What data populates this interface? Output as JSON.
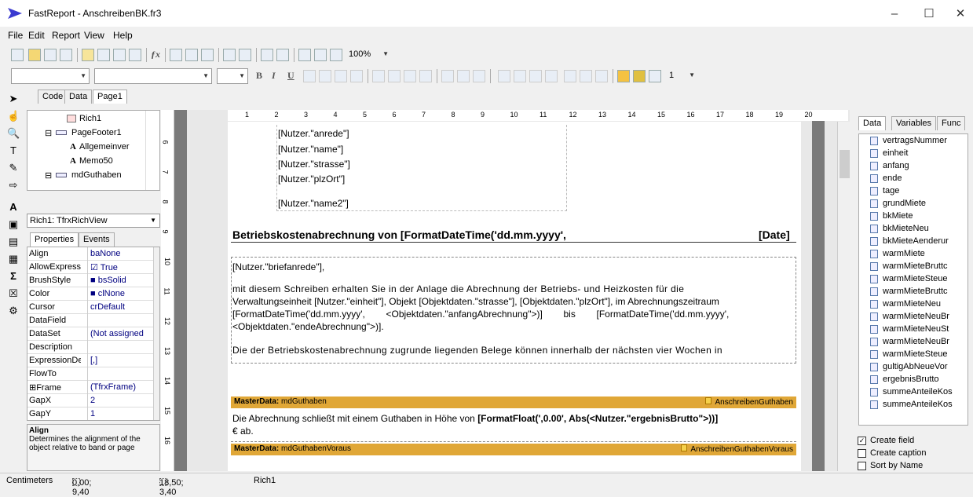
{
  "window": {
    "title": "FastReport - AnschreibenBK.fr3",
    "minimize": "–",
    "maximize": "☐",
    "close": "✕"
  },
  "menu": [
    "File",
    "Edit",
    "Report",
    "View",
    "Help"
  ],
  "toolbar": {
    "zoom": "100%",
    "linewidth": "1",
    "bold": "B",
    "italic": "I",
    "underline": "U"
  },
  "editor_tabs": [
    "Code",
    "Data",
    "Page1"
  ],
  "tree": [
    {
      "label": "Rich1",
      "indent": 60
    },
    {
      "label": "PageFooter1",
      "indent": 38
    },
    {
      "label": "Allgemeinver",
      "indent": 60
    },
    {
      "label": "Memo50",
      "indent": 60
    },
    {
      "label": "mdGuthaben",
      "indent": 38
    }
  ],
  "object_selector": "Rich1: TfrxRichView",
  "prop_tabs": [
    "Properties",
    "Events"
  ],
  "properties": [
    {
      "name": "Align",
      "value": "baNone"
    },
    {
      "name": "AllowExpress",
      "value": "☑ True"
    },
    {
      "name": "BrushStyle",
      "value": "■ bsSolid"
    },
    {
      "name": "Color",
      "value": "■ clNone"
    },
    {
      "name": "Cursor",
      "value": "crDefault"
    },
    {
      "name": "DataField",
      "value": ""
    },
    {
      "name": "DataSet",
      "value": "(Not assigned"
    },
    {
      "name": "Description",
      "value": ""
    },
    {
      "name": "ExpressionDe",
      "value": "[,]"
    },
    {
      "name": "FlowTo",
      "value": ""
    },
    {
      "name": "⊞Frame",
      "value": "(TfrxFrame)"
    },
    {
      "name": "GapX",
      "value": "2"
    },
    {
      "name": "GapY",
      "value": "1"
    }
  ],
  "prop_desc": {
    "title": "Align",
    "text": "Determines the alignment of the object relative to band or page"
  },
  "hruler": [
    "1",
    "2",
    "3",
    "4",
    "5",
    "6",
    "7",
    "8",
    "9",
    "10",
    "11",
    "12",
    "13",
    "14",
    "15",
    "16",
    "17",
    "18",
    "19",
    "20"
  ],
  "vruler": [
    "6",
    "7",
    "8",
    "9",
    "10",
    "11",
    "12",
    "13",
    "14",
    "15",
    "16"
  ],
  "page": {
    "address": [
      "[Nutzer.\"anrede\"]",
      "[Nutzer.\"name\"]",
      "[Nutzer.\"strasse\"]",
      "[Nutzer.\"plzOrt\"]",
      "[Nutzer.\"name2\"]"
    ],
    "heading": "Betriebskostenabrechnung von [FormatDateTime('dd.mm.yyyy',",
    "heading_right": "[Date]",
    "salutation": "[Nutzer.\"briefanrede\"],",
    "para1_l1": "mit diesem Schreiben erhalten Sie in der Anlage die Abrechnung der Betriebs- und Heizkosten für die",
    "para1_l2": "Verwaltungseinheit [Nutzer.\"einheit\"], Objekt [Objektdaten.\"strasse\"], [Objektdaten.\"plzOrt\"], im Abrechnungszeitraum",
    "para1_l3": "[FormatDateTime('dd.mm.yyyy',        <Objektdaten.\"anfangAbrechnung\">)]        bis        [FormatDateTime('dd.mm.yyyy',",
    "para1_l4": "<Objektdaten.\"endeAbrechnung\">)].",
    "para2": "Die der Betriebskostenabrechnung zugrunde liegenden Belege können innerhalb der nächsten vier Wochen in",
    "band1_left": "MasterData:",
    "band1_name": "mdGuthaben",
    "band1_right": "AnschreibenGuthaben",
    "guthaben_l1_a": "Die Abrechnung schließt mit einem Guthaben in Höhe von ",
    "guthaben_l1_b": "[FormatFloat(',0.00', Abs(<Nutzer.\"ergebnisBrutto\">))]",
    "guthaben_l2": "€ ab.",
    "band2_left": "MasterData:",
    "band2_name": "mdGuthabenVoraus",
    "band2_right": "AnschreibenGuthabenVoraus"
  },
  "right_tabs": [
    "Data",
    "Variables",
    "Func"
  ],
  "data_fields": [
    "vertragsNummer",
    "einheit",
    "anfang",
    "ende",
    "tage",
    "grundMiete",
    "bkMiete",
    "bkMieteNeu",
    "bkMieteAenderur",
    "warmMiete",
    "warmMieteBruttc",
    "warmMieteSteue",
    "warmMieteBruttc",
    "warmMieteNeu",
    "warmMieteNeuBr",
    "warmMieteNeuSt",
    "warmMieteNeuBr",
    "warmMieteSteue",
    "gultigAbNeueVor",
    "ergebnisBrutto",
    "summeAnteileKos",
    "summeAnteileKos"
  ],
  "options": [
    {
      "label": "Create field",
      "checked": true
    },
    {
      "label": "Create caption",
      "checked": false
    },
    {
      "label": "Sort by Name",
      "checked": false
    }
  ],
  "status": {
    "units": "Centimeters",
    "pos": "0,00; 9,40",
    "size": "18,50; 3,40",
    "name": "Rich1"
  }
}
